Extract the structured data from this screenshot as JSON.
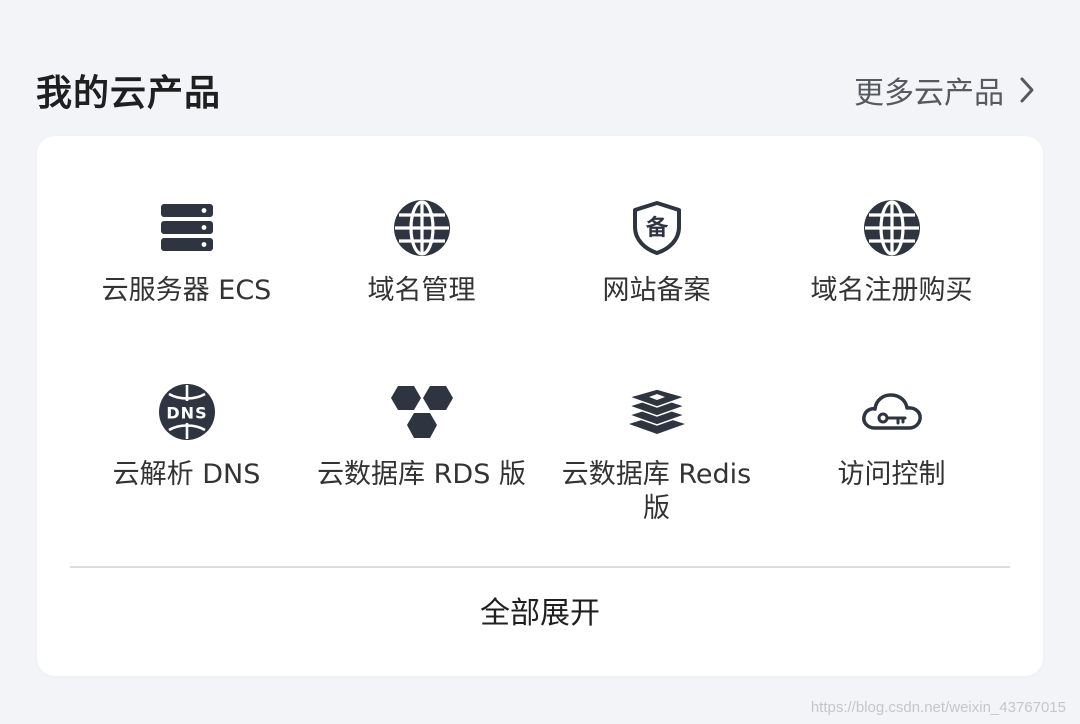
{
  "header": {
    "title": "我的云产品",
    "more_label": "更多云产品"
  },
  "products": [
    {
      "label": "云服务器 ECS",
      "icon": "server-icon"
    },
    {
      "label": "域名管理",
      "icon": "globe-icon"
    },
    {
      "label": "网站备案",
      "icon": "shield-bei-icon"
    },
    {
      "label": "域名注册购买",
      "icon": "globe-icon"
    },
    {
      "label": "云解析 DNS",
      "icon": "dns-icon"
    },
    {
      "label": "云数据库 RDS 版",
      "icon": "hexagons-icon"
    },
    {
      "label": "云数据库 Redis 版",
      "icon": "layers-icon"
    },
    {
      "label": "访问控制",
      "icon": "cloud-key-icon"
    }
  ],
  "footer": {
    "expand_label": "全部展开"
  },
  "watermark": "https://blog.csdn.net/weixin_43767015",
  "colors": {
    "background": "#f3f4f7",
    "card": "#ffffff",
    "icon": "#2f3540",
    "text": "#333333"
  }
}
